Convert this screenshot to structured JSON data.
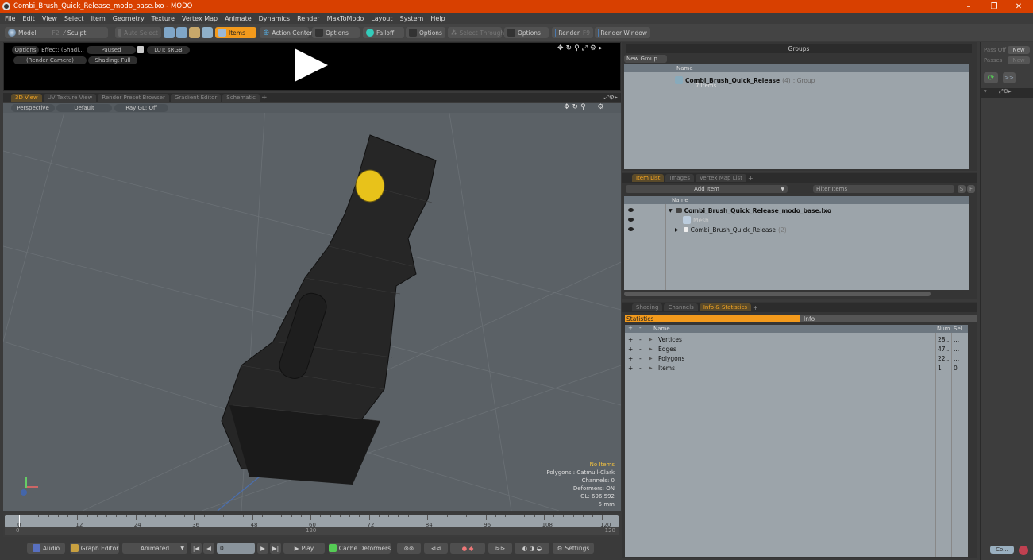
{
  "window": {
    "title": "Combi_Brush_Quick_Release_modo_base.lxo - MODO",
    "minimize": "–",
    "maximize": "❐",
    "close": "✕"
  },
  "menu": [
    "File",
    "Edit",
    "View",
    "Select",
    "Item",
    "Geometry",
    "Texture",
    "Vertex Map",
    "Animate",
    "Dynamics",
    "Render",
    "MaxToModo",
    "Layout",
    "System",
    "Help"
  ],
  "toolbar": {
    "model": "Model",
    "model_key": "F2",
    "sculpt": "Sculpt",
    "auto_select": "Auto Select",
    "items": "Items",
    "action_center": "Action Center",
    "options1": "Options",
    "falloff": "Falloff",
    "options2": "Options",
    "select_through": "Select Through",
    "options3": "Options",
    "render": "Render",
    "render_key": "F9",
    "render_window": "Render Window"
  },
  "render_panel": {
    "options": "Options",
    "effect": "Effect: (Shadi...",
    "paused": "Paused",
    "lut": "LUT: sRGB",
    "camera": "(Render Camera)",
    "shading": "Shading: Full"
  },
  "viewport_tabs": [
    "3D View",
    "UV Texture View",
    "Render Preset Browser",
    "Gradient Editor",
    "Schematic",
    "+"
  ],
  "viewport": {
    "perspective": "Perspective",
    "default": "Default",
    "raygl": "Ray GL: Off",
    "stats": {
      "selection": "No Items",
      "polygons": "Polygons : Catmull-Clark",
      "channels": "Channels: 0",
      "deformers": "Deformers: ON",
      "gl": "GL: 696,592",
      "scale": "5 mm"
    },
    "colors": {
      "model": "#2a2a2a",
      "button": "#e8c21a",
      "background": "#5b6166"
    }
  },
  "timeline": {
    "ticks": [
      "0",
      "12",
      "24",
      "36",
      "48",
      "60",
      "72",
      "84",
      "96",
      "108",
      "120"
    ],
    "sub_start": "0",
    "sub_mid": "120",
    "sub_end": "120"
  },
  "bottombar": {
    "audio": "Audio",
    "graph_editor": "Graph Editor",
    "animated": "Animated",
    "frame": "0",
    "play": "Play",
    "cache_deformers": "Cache Deformers",
    "settings": "Settings"
  },
  "groups": {
    "title": "Groups",
    "new_group": "New Group",
    "col_name": "Name",
    "row_name": "Combi_Brush_Quick_Release",
    "row_count": "(4)",
    "row_type": ": Group",
    "row_sub": "7 Items"
  },
  "item_list": {
    "tabs": [
      "Item List",
      "Images",
      "Vertex Map List",
      "+"
    ],
    "add_item": "Add Item",
    "filter_placeholder": "Filter Items",
    "s_btn": "S",
    "f_btn": "F",
    "col_name": "Name",
    "rows": [
      {
        "name": "Combi_Brush_Quick_Release_modo_base.lxo",
        "count": ""
      },
      {
        "name": "Mesh",
        "count": ""
      },
      {
        "name": "Combi_Brush_Quick_Release",
        "count": "(2)"
      }
    ]
  },
  "info_panel": {
    "tabs": [
      "Shading",
      "Channels",
      "Info & Statistics",
      "+"
    ],
    "statistics": "Statistics",
    "info": "Info",
    "col_name": "Name",
    "col_num": "Num",
    "col_sel": "Sel",
    "rows": [
      {
        "name": "Vertices",
        "num": "28...",
        "sel": "..."
      },
      {
        "name": "Edges",
        "num": "47...",
        "sel": "..."
      },
      {
        "name": "Polygons",
        "num": "22...",
        "sel": "..."
      },
      {
        "name": "Items",
        "num": "1",
        "sel": "0"
      }
    ]
  },
  "right_bar": {
    "pass_label": "Pass Off",
    "new": "New",
    "passes_label": "Passes",
    "new2": "New",
    "forward": ">>",
    "bottom_input": "Co..."
  }
}
